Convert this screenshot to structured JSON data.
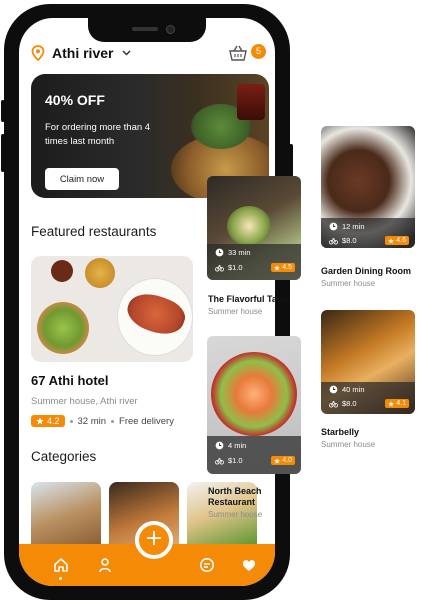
{
  "header": {
    "location": "Athi river",
    "cart_count": "5"
  },
  "promo": {
    "title": "40% OFF",
    "subtitle": "For ordering more than 4 times last month",
    "cta": "Claim now"
  },
  "featured": {
    "heading": "Featured restaurants",
    "name": "67 Athi hotel",
    "address": "Summer house, Athi river",
    "rating": "4.2",
    "time": "32 min",
    "delivery": "Free delivery"
  },
  "categories": {
    "heading": "Categories"
  },
  "side_cards": [
    {
      "name": "The Flavorful Table",
      "place": "Summer house",
      "time": "33 min",
      "price": "$1.0",
      "rating": "4.5"
    },
    {
      "name": "North Beach Restaurant",
      "place": "Summer house",
      "time": "4 min",
      "price": "$1.0",
      "rating": "4.0"
    },
    {
      "name": "Garden Dining Room",
      "place": "Summer house",
      "time": "12 min",
      "price": "$8.0",
      "rating": "4.6"
    },
    {
      "name": "Starbelly",
      "place": "Summer house",
      "time": "40 min",
      "price": "$8.0",
      "rating": "4.1"
    }
  ],
  "nav": {
    "fab_label": "+"
  },
  "colors": {
    "accent": "#f58a07",
    "dark": "#0d0d0d"
  },
  "icons": [
    "location-pin-icon",
    "chevron-down-icon",
    "basket-icon",
    "star-icon",
    "clock-icon",
    "bike-icon",
    "home-icon",
    "user-icon",
    "chat-icon",
    "heart-icon",
    "plus-icon"
  ]
}
